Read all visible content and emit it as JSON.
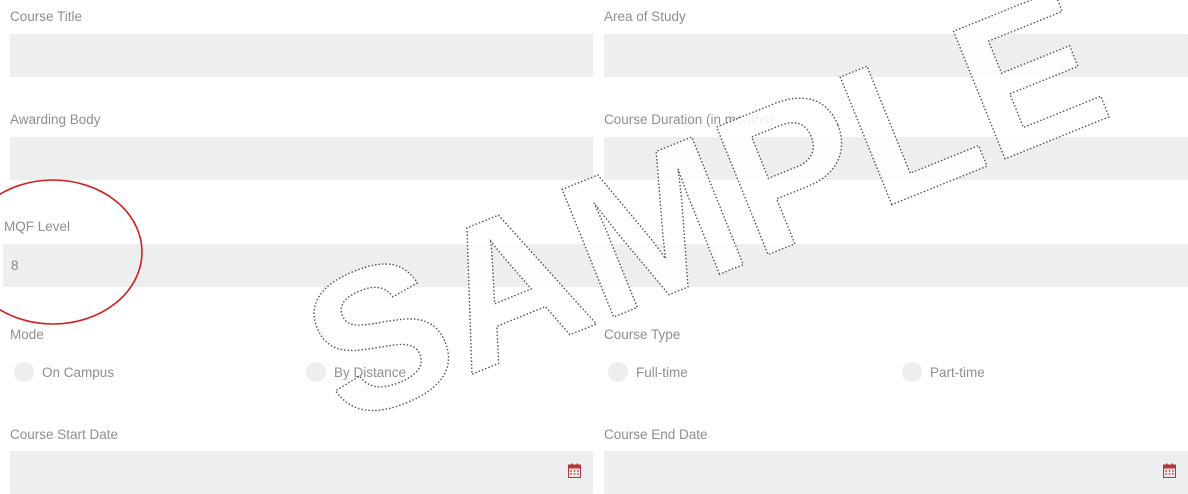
{
  "form": {
    "course_title": {
      "label": "Course Title",
      "value": ""
    },
    "area_of_study": {
      "label": "Area of Study",
      "value": ""
    },
    "awarding_body": {
      "label": "Awarding Body",
      "value": ""
    },
    "course_duration": {
      "label": "Course Duration (in months)",
      "value": ""
    },
    "mqf_level": {
      "label": "MQF Level",
      "value": "8"
    },
    "mode": {
      "label": "Mode",
      "options": [
        {
          "label": "On Campus",
          "selected": false
        },
        {
          "label": "By Distance",
          "selected": false
        }
      ]
    },
    "course_type": {
      "label": "Course Type",
      "options": [
        {
          "label": "Full-time",
          "selected": false
        },
        {
          "label": "Part-time",
          "selected": false
        }
      ]
    },
    "course_start_date": {
      "label": "Course Start Date",
      "value": "",
      "icon": "calendar-icon"
    },
    "course_end_date": {
      "label": "Course End Date",
      "value": "",
      "icon": "calendar-icon"
    }
  },
  "watermark": {
    "text": "SAMPLE"
  },
  "annotation": {
    "color": "#d31f1f"
  },
  "colors": {
    "field_bg": "#eceeef",
    "label": "#8f8f8f",
    "calendar": "#b03a3a"
  }
}
